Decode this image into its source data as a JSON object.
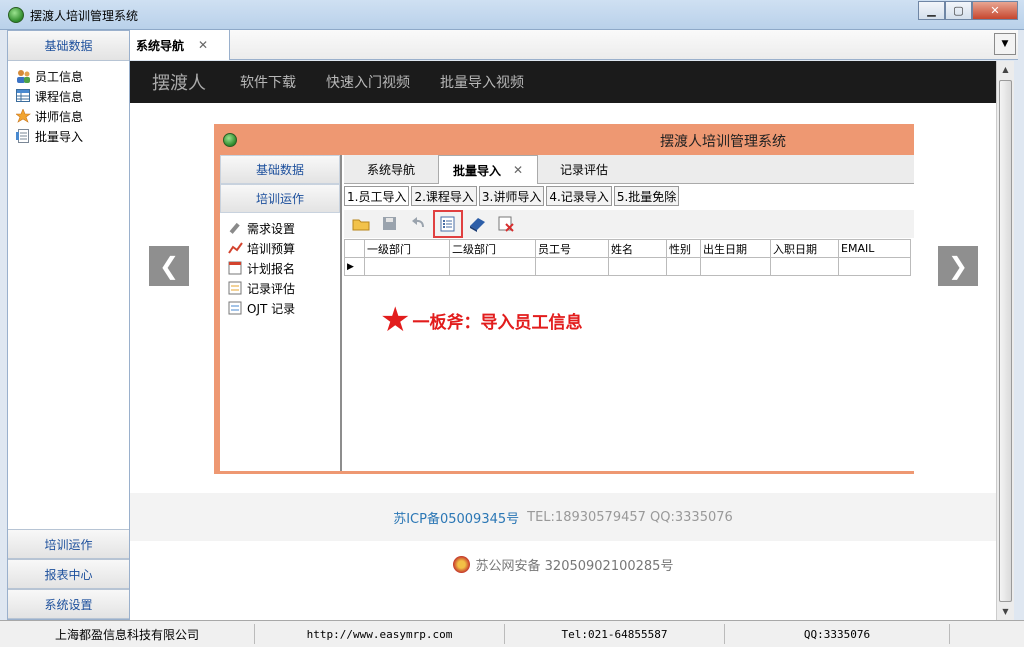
{
  "window": {
    "title": "摆渡人培训管理系统"
  },
  "nav": {
    "top_header": "基础数据",
    "items": [
      {
        "label": "员工信息",
        "icon": "users-icon"
      },
      {
        "label": "课程信息",
        "icon": "table-icon"
      },
      {
        "label": "讲师信息",
        "icon": "star-person-icon"
      },
      {
        "label": "批量导入",
        "icon": "import-icon"
      }
    ],
    "bottom": [
      "培训运作",
      "报表中心",
      "系统设置"
    ]
  },
  "tab": {
    "label": "系统导航",
    "close": "✕"
  },
  "site": {
    "brand": "摆渡人",
    "links": [
      "软件下载",
      "快速入门视频",
      "批量导入视频"
    ],
    "prev": "❮",
    "next": "❯",
    "icp": "苏ICP备05009345号",
    "contact": "TEL:18930579457 QQ:3335076",
    "police": "苏公网安备 32050902100285号"
  },
  "shot": {
    "title": "摆渡人培训管理系统",
    "nav_header": "基础数据",
    "nav_header2": "培训运作",
    "nav_items": [
      "需求设置",
      "培训预算",
      "计划报名",
      "记录评估",
      "OJT 记录"
    ],
    "tabs": [
      "系统导航",
      "批量导入",
      "记录评估"
    ],
    "tab_close": "✕",
    "subtabs": [
      "1.员工导入",
      "2.课程导入",
      "3.讲师导入",
      "4.记录导入",
      "5.批量免除"
    ],
    "columns": [
      "一级部门",
      "二级部门",
      "员工号",
      "姓名",
      "性别",
      "出生日期",
      "入职日期",
      "EMAIL"
    ],
    "row_marker": "▶",
    "callout": "一板斧：导入员工信息"
  },
  "status": {
    "company": "上海都盈信息科技有限公司",
    "url": "http://www.easymrp.com",
    "tel": "Tel:021-64855587",
    "qq": "QQ:3335076"
  },
  "colors": {
    "accent": "#1c4f9c",
    "shot_border": "#ee9872",
    "callout": "#e21c1c"
  }
}
